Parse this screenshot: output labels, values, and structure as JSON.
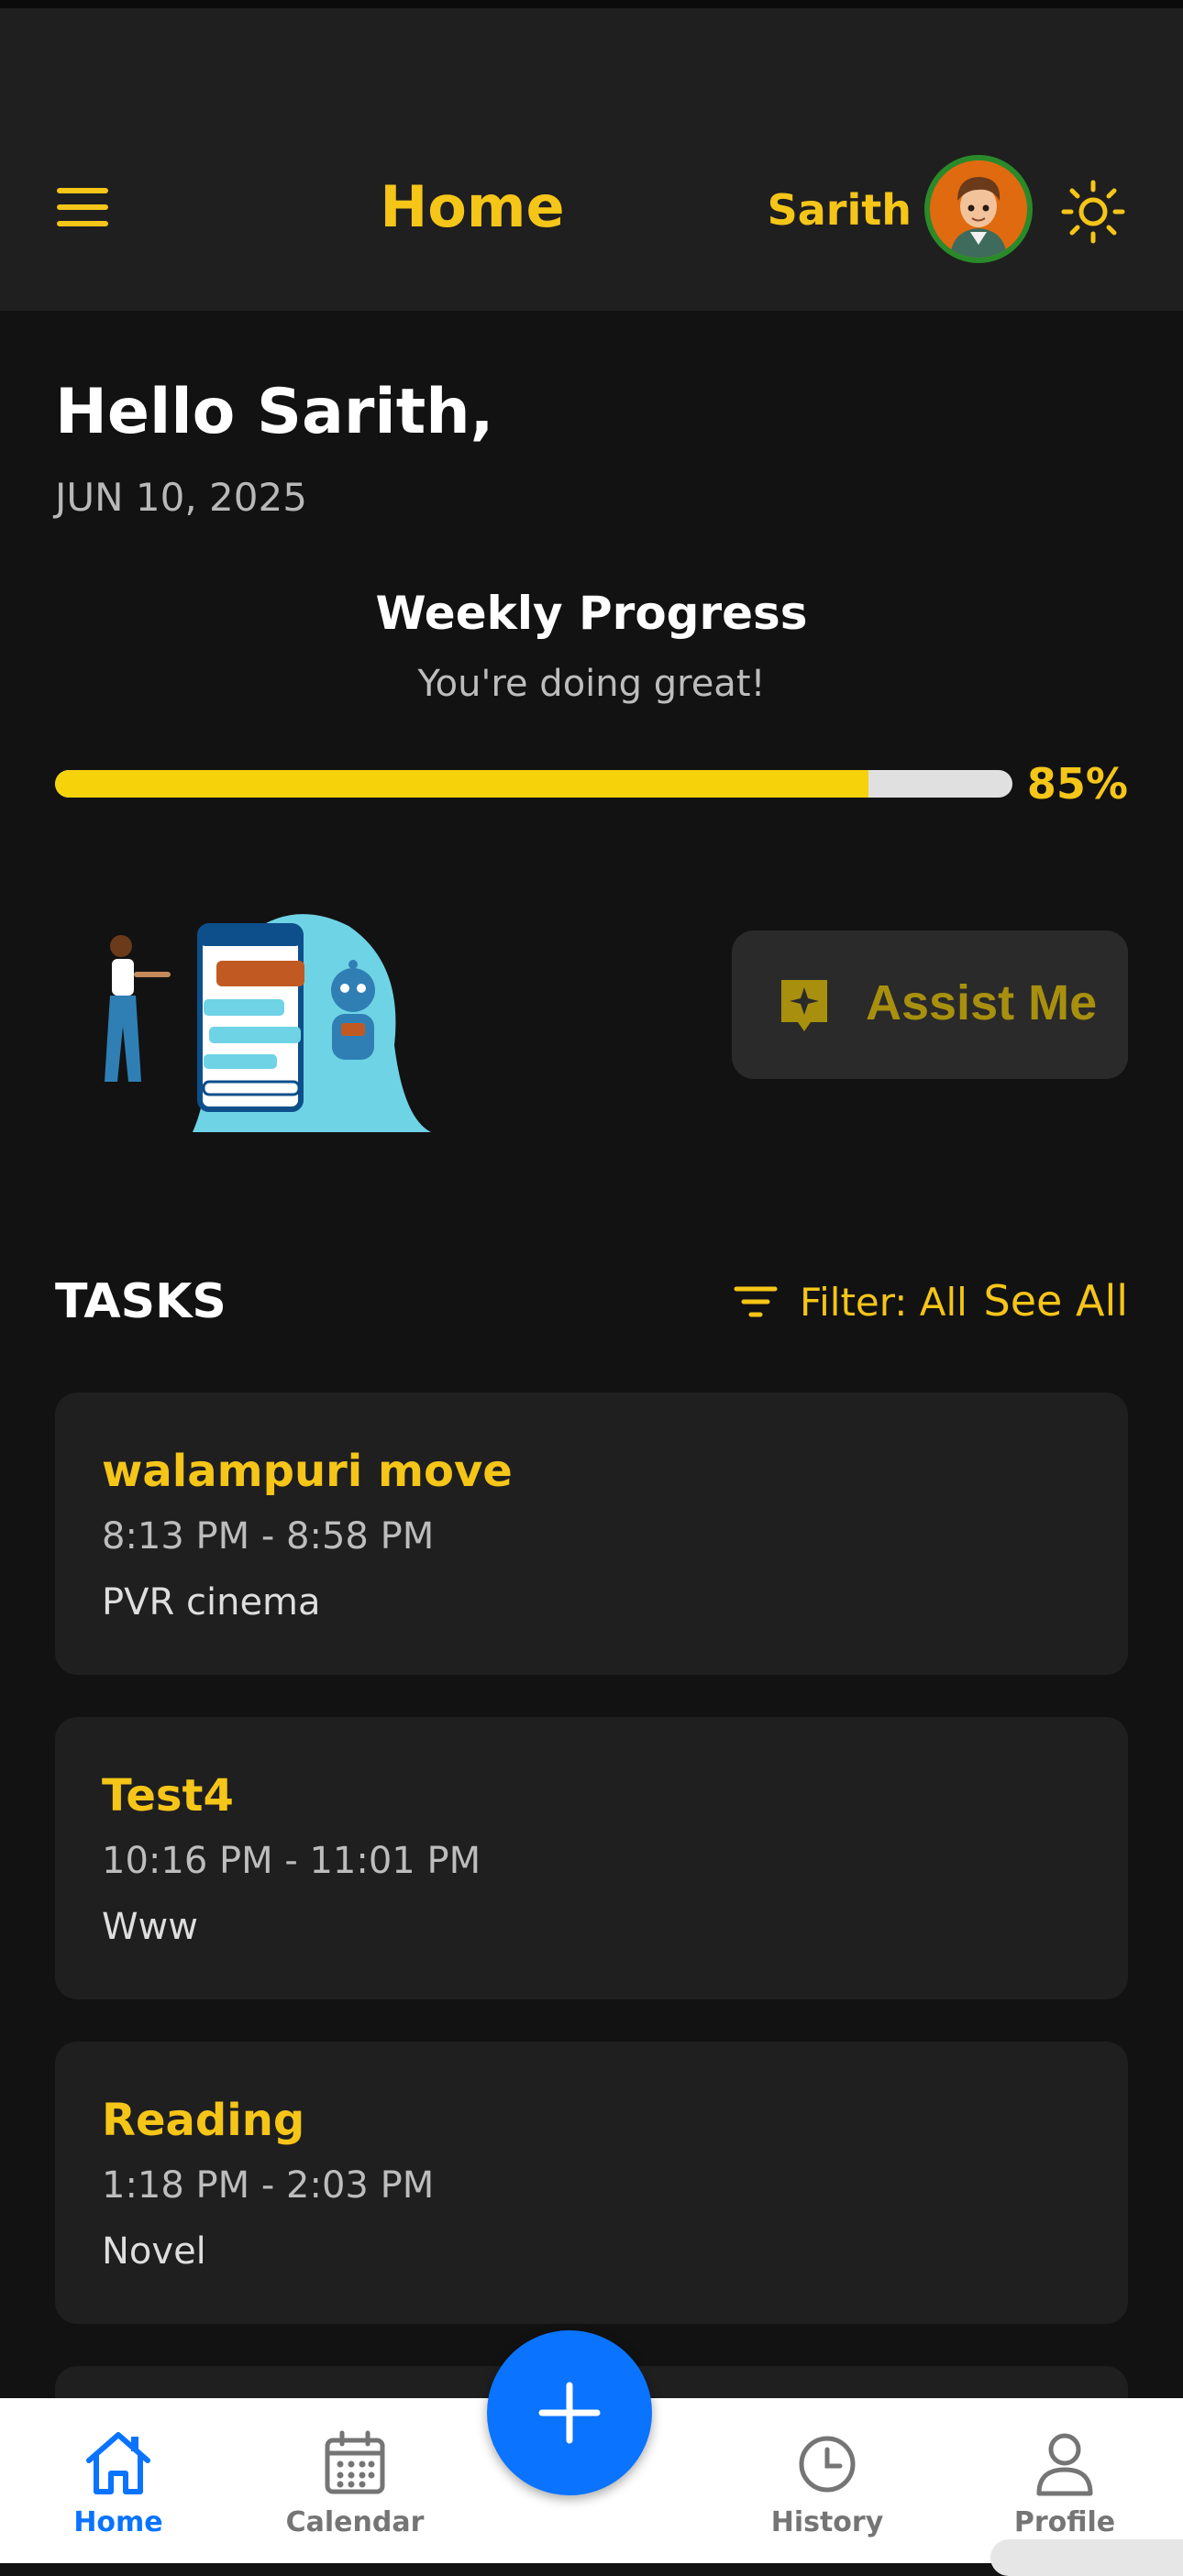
{
  "header": {
    "title": "Home",
    "user_name": "Sarith",
    "menu_icon": "hamburger-menu-icon",
    "theme_icon": "sun-icon"
  },
  "greeting": {
    "hello": "Hello Sarith,",
    "date": "JUN 10, 2025"
  },
  "progress": {
    "title": "Weekly Progress",
    "subtitle": "You're doing great!",
    "percent_label": "85%",
    "value": 0.85
  },
  "assist": {
    "label": "Assist Me",
    "icon": "sparkle-icon"
  },
  "tasks": {
    "heading": "TASKS",
    "filter_label": "Filter: All",
    "see_all_label": "See All",
    "items": [
      {
        "title": "walampuri move",
        "time": "8:13 PM - 8:58 PM",
        "desc": "PVR cinema"
      },
      {
        "title": "Test4",
        "time": "10:16 PM - 11:01 PM",
        "desc": "Www"
      },
      {
        "title": "Reading",
        "time": "1:18 PM - 2:03 PM",
        "desc": "Novel"
      }
    ]
  },
  "nav": {
    "items": [
      {
        "label": "Home",
        "icon": "home-icon",
        "active": true
      },
      {
        "label": "Calendar",
        "icon": "calendar-icon",
        "active": false
      },
      {
        "label": "History",
        "icon": "clock-icon",
        "active": false
      },
      {
        "label": "Profile",
        "icon": "person-icon",
        "active": false
      }
    ],
    "fab_icon": "plus-icon"
  },
  "colors": {
    "accent": "#f5c518",
    "background": "#121212",
    "card": "#1f1f1f",
    "nav_active": "#0a73ff"
  }
}
